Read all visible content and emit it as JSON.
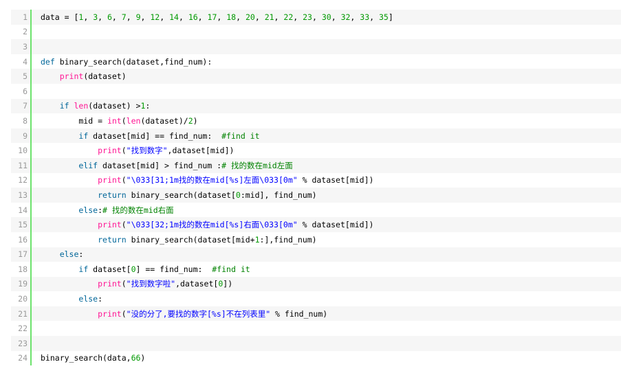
{
  "colors": {
    "keyword": "#006699",
    "builtin": "#ff1493",
    "string": "#0000ff",
    "number": "#009900",
    "comment": "#008200",
    "gutter_border": "#6ce26c",
    "line_number": "#999999",
    "alt_row": "#f6f6f6"
  },
  "lines": [
    {
      "n": "1",
      "tokens": [
        [
          "t",
          "data = ["
        ],
        [
          "num",
          "1"
        ],
        [
          "t",
          ", "
        ],
        [
          "num",
          "3"
        ],
        [
          "t",
          ", "
        ],
        [
          "num",
          "6"
        ],
        [
          "t",
          ", "
        ],
        [
          "num",
          "7"
        ],
        [
          "t",
          ", "
        ],
        [
          "num",
          "9"
        ],
        [
          "t",
          ", "
        ],
        [
          "num",
          "12"
        ],
        [
          "t",
          ", "
        ],
        [
          "num",
          "14"
        ],
        [
          "t",
          ", "
        ],
        [
          "num",
          "16"
        ],
        [
          "t",
          ", "
        ],
        [
          "num",
          "17"
        ],
        [
          "t",
          ", "
        ],
        [
          "num",
          "18"
        ],
        [
          "t",
          ", "
        ],
        [
          "num",
          "20"
        ],
        [
          "t",
          ", "
        ],
        [
          "num",
          "21"
        ],
        [
          "t",
          ", "
        ],
        [
          "num",
          "22"
        ],
        [
          "t",
          ", "
        ],
        [
          "num",
          "23"
        ],
        [
          "t",
          ", "
        ],
        [
          "num",
          "30"
        ],
        [
          "t",
          ", "
        ],
        [
          "num",
          "32"
        ],
        [
          "t",
          ", "
        ],
        [
          "num",
          "33"
        ],
        [
          "t",
          ", "
        ],
        [
          "num",
          "35"
        ],
        [
          "t",
          "]"
        ]
      ]
    },
    {
      "n": "2",
      "tokens": []
    },
    {
      "n": "3",
      "tokens": []
    },
    {
      "n": "4",
      "tokens": [
        [
          "kw",
          "def"
        ],
        [
          "t",
          " binary_search(dataset,find_num):"
        ]
      ]
    },
    {
      "n": "5",
      "tokens": [
        [
          "t",
          "    "
        ],
        [
          "bi",
          "print"
        ],
        [
          "t",
          "(dataset)"
        ]
      ]
    },
    {
      "n": "6",
      "tokens": []
    },
    {
      "n": "7",
      "tokens": [
        [
          "t",
          "    "
        ],
        [
          "kw",
          "if"
        ],
        [
          "t",
          " "
        ],
        [
          "bi",
          "len"
        ],
        [
          "t",
          "(dataset) >"
        ],
        [
          "num",
          "1"
        ],
        [
          "t",
          ":"
        ]
      ]
    },
    {
      "n": "8",
      "tokens": [
        [
          "t",
          "        mid = "
        ],
        [
          "bi",
          "int"
        ],
        [
          "t",
          "("
        ],
        [
          "bi",
          "len"
        ],
        [
          "t",
          "(dataset)/"
        ],
        [
          "num",
          "2"
        ],
        [
          "t",
          ")"
        ]
      ]
    },
    {
      "n": "9",
      "tokens": [
        [
          "t",
          "        "
        ],
        [
          "kw",
          "if"
        ],
        [
          "t",
          " dataset[mid] == find_num:  "
        ],
        [
          "cm",
          "#find it"
        ]
      ]
    },
    {
      "n": "10",
      "tokens": [
        [
          "t",
          "            "
        ],
        [
          "bi",
          "print"
        ],
        [
          "t",
          "("
        ],
        [
          "str",
          "\"找到数字\""
        ],
        [
          "t",
          ",dataset[mid])"
        ]
      ]
    },
    {
      "n": "11",
      "tokens": [
        [
          "t",
          "        "
        ],
        [
          "kw",
          "elif"
        ],
        [
          "t",
          " dataset[mid] > find_num :"
        ],
        [
          "cm",
          "# 找的数在mid左面"
        ]
      ]
    },
    {
      "n": "12",
      "tokens": [
        [
          "t",
          "            "
        ],
        [
          "bi",
          "print"
        ],
        [
          "t",
          "("
        ],
        [
          "str",
          "\"\\033[31;1m找的数在mid[%s]左面\\033[0m\""
        ],
        [
          "t",
          " % dataset[mid])"
        ]
      ]
    },
    {
      "n": "13",
      "tokens": [
        [
          "t",
          "            "
        ],
        [
          "kw",
          "return"
        ],
        [
          "t",
          " binary_search(dataset["
        ],
        [
          "num",
          "0"
        ],
        [
          "t",
          ":mid], find_num)"
        ]
      ]
    },
    {
      "n": "14",
      "tokens": [
        [
          "t",
          "        "
        ],
        [
          "kw",
          "else"
        ],
        [
          "t",
          ":"
        ],
        [
          "cm",
          "# 找的数在mid右面"
        ]
      ]
    },
    {
      "n": "15",
      "tokens": [
        [
          "t",
          "            "
        ],
        [
          "bi",
          "print"
        ],
        [
          "t",
          "("
        ],
        [
          "str",
          "\"\\033[32;1m找的数在mid[%s]右面\\033[0m\""
        ],
        [
          "t",
          " % dataset[mid])"
        ]
      ]
    },
    {
      "n": "16",
      "tokens": [
        [
          "t",
          "            "
        ],
        [
          "kw",
          "return"
        ],
        [
          "t",
          " binary_search(dataset[mid+"
        ],
        [
          "num",
          "1"
        ],
        [
          "t",
          ":],find_num)"
        ]
      ]
    },
    {
      "n": "17",
      "tokens": [
        [
          "t",
          "    "
        ],
        [
          "kw",
          "else"
        ],
        [
          "t",
          ":"
        ]
      ]
    },
    {
      "n": "18",
      "tokens": [
        [
          "t",
          "        "
        ],
        [
          "kw",
          "if"
        ],
        [
          "t",
          " dataset["
        ],
        [
          "num",
          "0"
        ],
        [
          "t",
          "] == find_num:  "
        ],
        [
          "cm",
          "#find it"
        ]
      ]
    },
    {
      "n": "19",
      "tokens": [
        [
          "t",
          "            "
        ],
        [
          "bi",
          "print"
        ],
        [
          "t",
          "("
        ],
        [
          "str",
          "\"找到数字啦\""
        ],
        [
          "t",
          ",dataset["
        ],
        [
          "num",
          "0"
        ],
        [
          "t",
          "])"
        ]
      ]
    },
    {
      "n": "20",
      "tokens": [
        [
          "t",
          "        "
        ],
        [
          "kw",
          "else"
        ],
        [
          "t",
          ":"
        ]
      ]
    },
    {
      "n": "21",
      "tokens": [
        [
          "t",
          "            "
        ],
        [
          "bi",
          "print"
        ],
        [
          "t",
          "("
        ],
        [
          "str",
          "\"没的分了,要找的数字[%s]不在列表里\""
        ],
        [
          "t",
          " % find_num)"
        ]
      ]
    },
    {
      "n": "22",
      "tokens": []
    },
    {
      "n": "23",
      "tokens": []
    },
    {
      "n": "24",
      "tokens": [
        [
          "t",
          "binary_search(data,"
        ],
        [
          "num",
          "66"
        ],
        [
          "t",
          ")"
        ]
      ]
    }
  ]
}
